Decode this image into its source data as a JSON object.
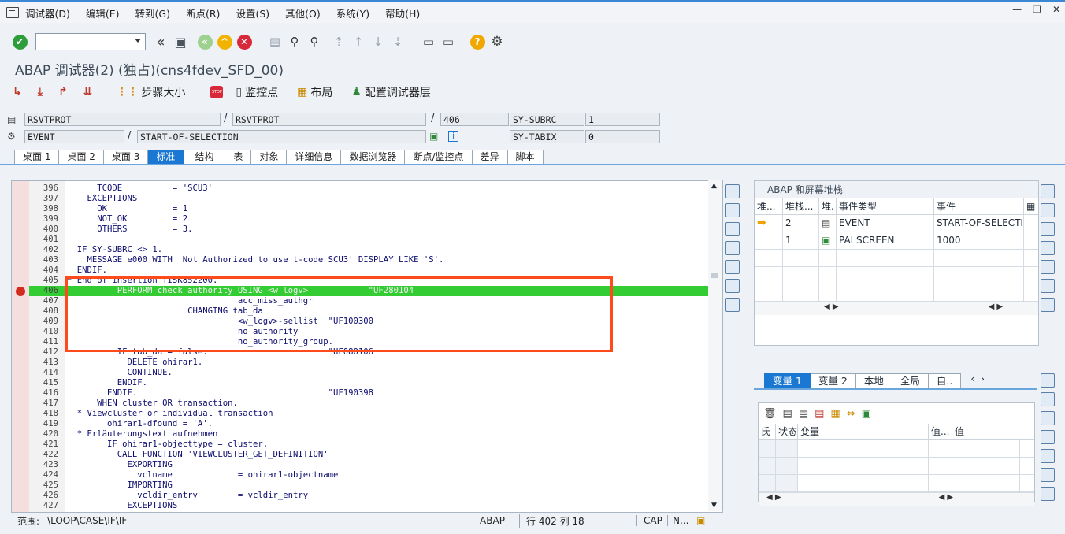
{
  "menu": [
    "调试器(D)",
    "编辑(E)",
    "转到(G)",
    "断点(R)",
    "设置(S)",
    "其他(O)",
    "系统(Y)",
    "帮助(H)"
  ],
  "title": "ABAP 调试器(2)  (独占)(cns4fdev_SFD_00)",
  "debug_toolbar": {
    "step_size": "步骤大小",
    "watchpoint": "监控点",
    "layout": "布局",
    "config": "配置调试器层"
  },
  "info": {
    "program": "RSVTPROT",
    "include": "RSVTPROT",
    "line": "406",
    "subrc_label": "SY-SUBRC",
    "subrc_value": "1",
    "event_type": "EVENT",
    "event_name": "START-OF-SELECTION",
    "tabix_label": "SY-TABIX",
    "tabix_value": "0"
  },
  "tabs": [
    "桌面 1",
    "桌面 2",
    "桌面 3",
    "标准",
    "结构",
    "表",
    "对象",
    "详细信息",
    "数据浏览器",
    "断点/监控点",
    "差异",
    "脚本"
  ],
  "code_lines": [
    {
      "n": "396",
      "t": "      TCODE          = 'SCU3'"
    },
    {
      "n": "397",
      "t": "    EXCEPTIONS"
    },
    {
      "n": "398",
      "t": "      OK             = 1"
    },
    {
      "n": "399",
      "t": "      NOT_OK         = 2"
    },
    {
      "n": "400",
      "t": "      OTHERS         = 3."
    },
    {
      "n": "401",
      "t": ""
    },
    {
      "n": "402",
      "t": "  IF SY-SUBRC <> 1."
    },
    {
      "n": "403",
      "t": "    MESSAGE e000 WITH 'Not Authorized to use t-code SCU3' DISPLAY LIKE 'S'."
    },
    {
      "n": "404",
      "t": "  ENDIF."
    },
    {
      "n": "405",
      "t": "* End of insertion TISK852200."
    },
    {
      "n": "406",
      "t": "          PERFORM check_authority USING <w_logv>            \"UF280104"
    },
    {
      "n": "407",
      "t": "                                  acc_miss_authgr"
    },
    {
      "n": "408",
      "t": "                        CHANGING tab_da"
    },
    {
      "n": "409",
      "t": "                                  <w_logv>-sellist  \"UF100300"
    },
    {
      "n": "410",
      "t": "                                  no_authority"
    },
    {
      "n": "411",
      "t": "                                  no_authority_group."
    },
    {
      "n": "412",
      "t": "          IF tab_da = false.                        \"UF080106"
    },
    {
      "n": "413",
      "t": "            DELETE ohirar1."
    },
    {
      "n": "414",
      "t": "            CONTINUE."
    },
    {
      "n": "415",
      "t": "          ENDIF."
    },
    {
      "n": "416",
      "t": "        ENDIF.                                      \"UF190398"
    },
    {
      "n": "417",
      "t": "      WHEN cluster OR transaction."
    },
    {
      "n": "418",
      "t": "  * Viewcluster or individual transaction"
    },
    {
      "n": "419",
      "t": "        ohirar1-dfound = 'A'."
    },
    {
      "n": "420",
      "t": "  * Erläuterungstext aufnehmen"
    },
    {
      "n": "421",
      "t": "        IF ohirar1-objecttype = cluster."
    },
    {
      "n": "422",
      "t": "          CALL FUNCTION 'VIEWCLUSTER_GET_DEFINITION'"
    },
    {
      "n": "423",
      "t": "            EXPORTING"
    },
    {
      "n": "424",
      "t": "              vclname             = ohirar1-objectname"
    },
    {
      "n": "425",
      "t": "            IMPORTING"
    },
    {
      "n": "426",
      "t": "              vcldir_entry        = vcldir_entry"
    },
    {
      "n": "427",
      "t": "            EXCEPTIONS"
    }
  ],
  "status": {
    "scope_label": "范围:",
    "scope": "\\LOOP\\CASE\\IF\\IF",
    "lang": "ABAP",
    "pos": "行 402 列  18",
    "caps": "CAP",
    "num": "N..."
  },
  "stack": {
    "title": "ABAP 和屏幕堆栈",
    "headers": [
      "堆...",
      "堆栈...",
      "堆.",
      "事件类型",
      "事件"
    ],
    "rows": [
      {
        "marker": "➡",
        "level": "2",
        "icon": "event",
        "type": "EVENT",
        "event": "START-OF-SELECTIC"
      },
      {
        "marker": "",
        "level": "1",
        "icon": "screen",
        "type": "PAI SCREEN",
        "event": "1000"
      }
    ]
  },
  "var_tabs": [
    "变量 1",
    "变量 2",
    "本地",
    "全局",
    "自.."
  ],
  "var_headers": [
    "氐",
    "状态",
    "变量",
    "值...",
    "值"
  ],
  "colors": {
    "accent": "#1b78d2",
    "current_line": "#33cc33",
    "highlight_box": "#ff4a1c",
    "breakpoint": "#d52b1e"
  }
}
